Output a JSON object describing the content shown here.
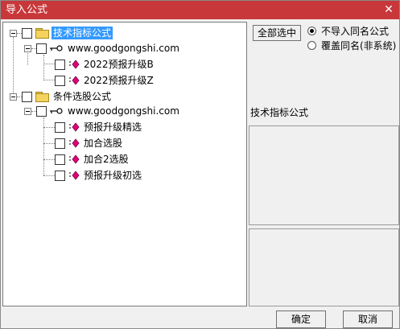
{
  "window": {
    "title": "导入公式",
    "close_glyph": "✕"
  },
  "tree": {
    "group1": {
      "label": "技术指标公式",
      "source": "www.goodgongshi.com",
      "items": [
        "2022预报升级B",
        "2022预报升级Z"
      ]
    },
    "group2": {
      "label": "条件选股公式",
      "source": "www.goodgongshi.com",
      "items": [
        "预报升级精选",
        "加合选股",
        "加合2选股",
        "预报升级初选"
      ]
    }
  },
  "options": {
    "select_all_label": "全部选中",
    "radio_skip_label": "不导入同名公式",
    "radio_overwrite_label": "覆盖同名(非系统)"
  },
  "detail": {
    "section_label": "技术指标公式"
  },
  "buttons": {
    "ok": "确定",
    "cancel": "取消"
  },
  "colors": {
    "titlebar": "#c8373a",
    "selection": "#3399ff",
    "formula_icon": "#e0007a"
  }
}
